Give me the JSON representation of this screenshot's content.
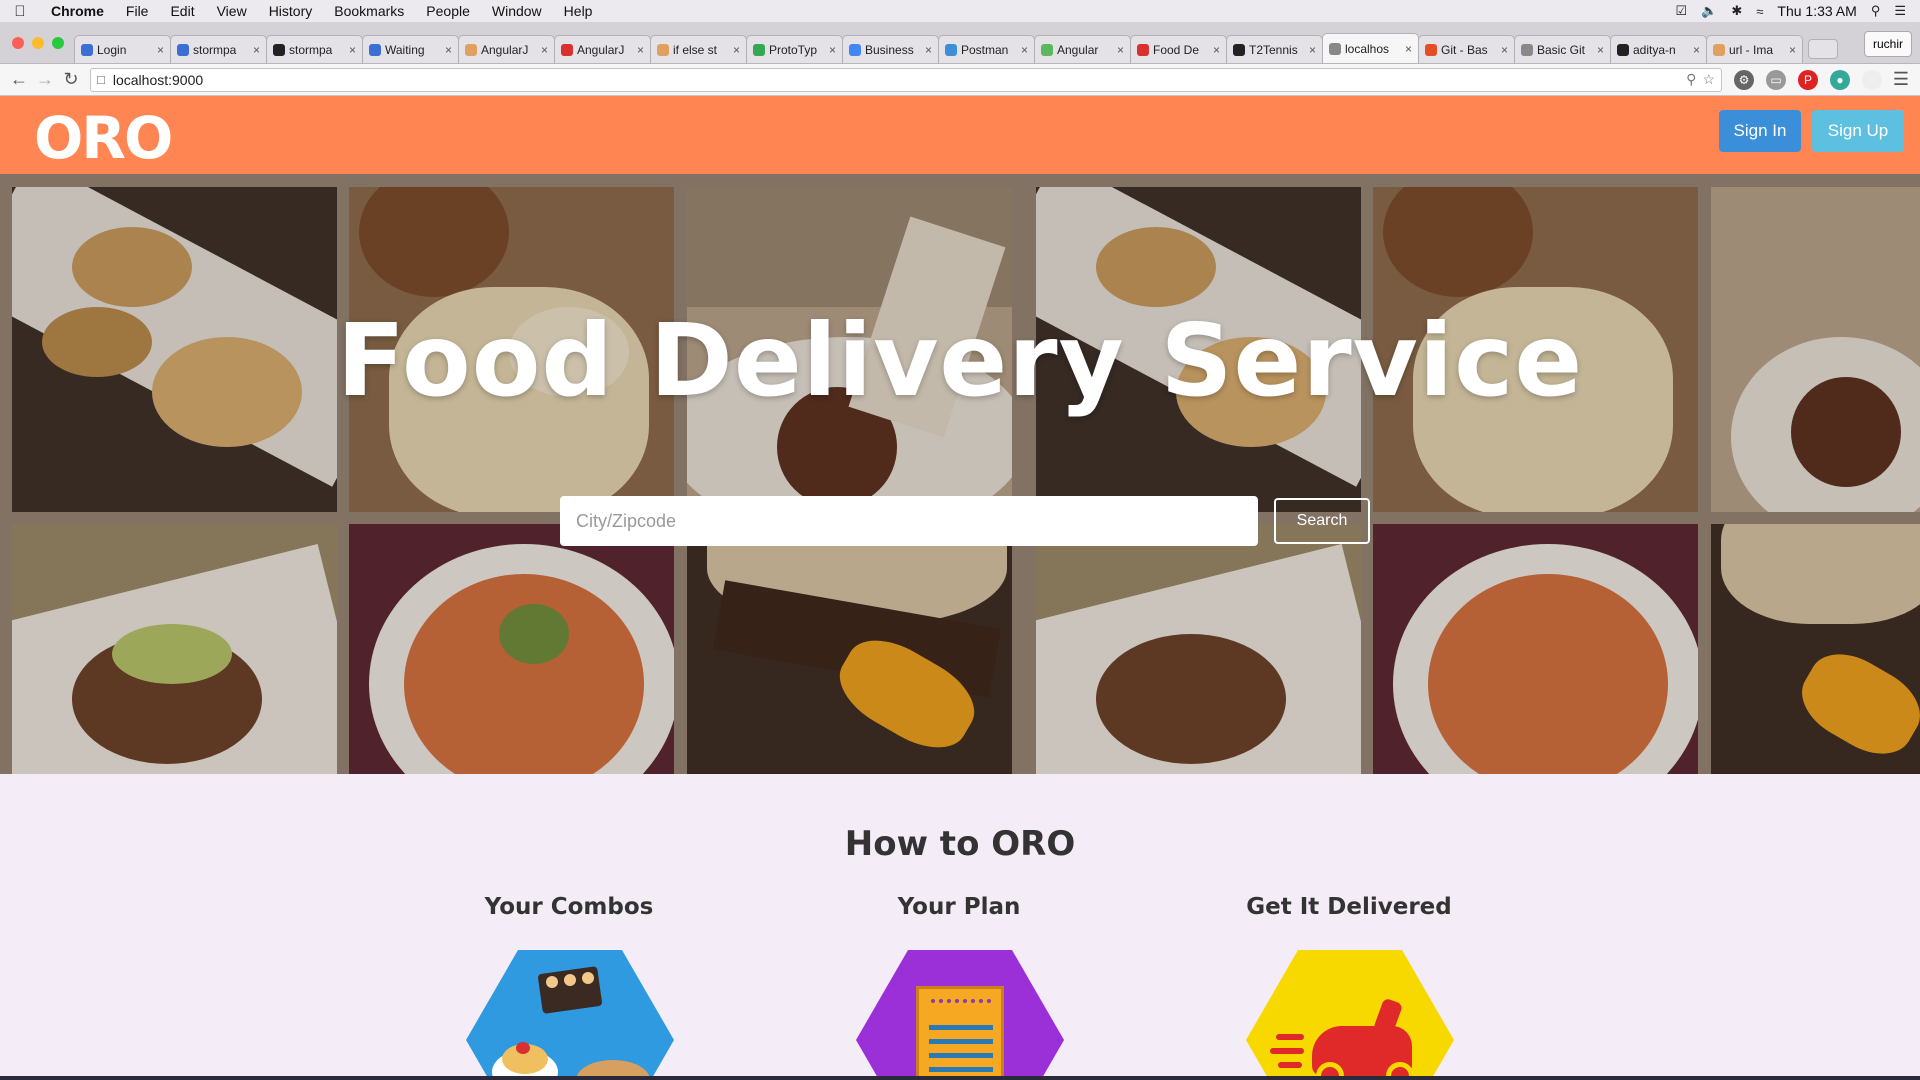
{
  "menubar": {
    "app": "Chrome",
    "items": [
      "File",
      "Edit",
      "View",
      "History",
      "Bookmarks",
      "People",
      "Window",
      "Help"
    ],
    "clock": "Thu 1:33 AM"
  },
  "tabs": [
    {
      "title": "Login",
      "color": "#3b6fd4"
    },
    {
      "title": "stormpa",
      "color": "#3b6fd4"
    },
    {
      "title": "stormpa",
      "color": "#222222"
    },
    {
      "title": "Waiting",
      "color": "#3b6fd4"
    },
    {
      "title": "AngularJ",
      "color": "#e0a060"
    },
    {
      "title": "AngularJ",
      "color": "#d8322f"
    },
    {
      "title": "if else st",
      "color": "#e0a060"
    },
    {
      "title": "ProtoTyp",
      "color": "#34a853"
    },
    {
      "title": "Business",
      "color": "#4285f4"
    },
    {
      "title": "Postman",
      "color": "#3b8fd8"
    },
    {
      "title": "Angular",
      "color": "#5cb85c"
    },
    {
      "title": "Food De",
      "color": "#d8322f"
    },
    {
      "title": "T2Tennis",
      "color": "#222222"
    },
    {
      "title": "localhos",
      "color": "#888888",
      "active": true
    },
    {
      "title": "Git - Bas",
      "color": "#e44d26"
    },
    {
      "title": "Basic Git",
      "color": "#888888"
    },
    {
      "title": "aditya-n",
      "color": "#222222"
    },
    {
      "title": "url - Ima",
      "color": "#e0a060"
    }
  ],
  "profile": "ruchir",
  "address": {
    "url": "localhost:9000"
  },
  "site": {
    "logo": "ORO",
    "signin_label": "Sign In",
    "signup_label": "Sign Up",
    "header_color": "#ff8553"
  },
  "hero": {
    "title": "Food Delivery Service",
    "search_placeholder": "City/Zipcode",
    "search_button": "Search"
  },
  "howto": {
    "title": "How to ORO",
    "steps": [
      {
        "title": "Your Combos",
        "color": "#2f9ae0",
        "icon": "food-combo-icon"
      },
      {
        "title": "Your Plan",
        "color": "#9b30d9",
        "icon": "plan-document-icon"
      },
      {
        "title": "Get It Delivered",
        "color": "#f7d900",
        "icon": "delivery-scooter-icon"
      }
    ]
  }
}
